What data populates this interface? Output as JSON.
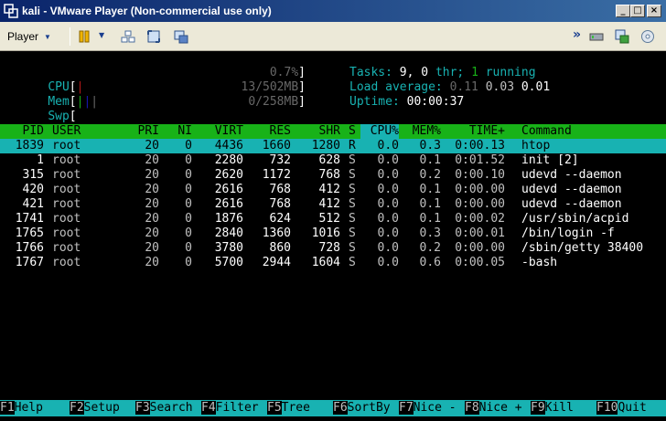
{
  "window": {
    "title": "kali - VMware Player (Non-commercial use only)",
    "min_glyph": "_",
    "max_glyph": "□",
    "close_glyph": "×"
  },
  "toolbar": {
    "player_label": "Player",
    "icons": [
      "pause-icon",
      "send-ctrl-alt-del-icon",
      "fullscreen-icon",
      "unity-icon",
      "forward-icon",
      "network-adapter-icon",
      "usb-device-icon",
      "cd-drive-icon"
    ]
  },
  "meters": {
    "cpu": {
      "label": "CPU",
      "value": "0.7%"
    },
    "mem": {
      "label": "Mem",
      "value": "13/502MB"
    },
    "swp": {
      "label": "Swp",
      "value": "0/258MB"
    }
  },
  "stats": {
    "tasks_label": "Tasks:",
    "tasks_count": "9,",
    "threads_count": "0",
    "threads_label": "thr;",
    "running_count": "1",
    "running_label": "running",
    "load_label": "Load average:",
    "load_1": "0.11",
    "load_5": "0.03",
    "load_15": "0.01",
    "uptime_label": "Uptime:",
    "uptime_value": "00:00:37"
  },
  "columns": {
    "pid": "PID",
    "user": "USER",
    "pri": "PRI",
    "ni": "NI",
    "virt": "VIRT",
    "res": "RES",
    "shr": "SHR",
    "s": "S",
    "cpu": "CPU%",
    "mem": "MEM%",
    "time": "TIME+",
    "command": "Command"
  },
  "processes": [
    {
      "pid": "1839",
      "user": "root",
      "pri": "20",
      "ni": "0",
      "virt": "4436",
      "res": "1660",
      "shr": "1280",
      "s": "R",
      "cpu": "0.0",
      "mem": "0.3",
      "time": "0:00.13",
      "command": "htop"
    },
    {
      "pid": "1",
      "user": "root",
      "pri": "20",
      "ni": "0",
      "virt": "2280",
      "res": "732",
      "shr": "628",
      "s": "S",
      "cpu": "0.0",
      "mem": "0.1",
      "time": "0:01.52",
      "command": "init [2]"
    },
    {
      "pid": "315",
      "user": "root",
      "pri": "20",
      "ni": "0",
      "virt": "2620",
      "res": "1172",
      "shr": "768",
      "s": "S",
      "cpu": "0.0",
      "mem": "0.2",
      "time": "0:00.10",
      "command": "udevd --daemon"
    },
    {
      "pid": "420",
      "user": "root",
      "pri": "20",
      "ni": "0",
      "virt": "2616",
      "res": "768",
      "shr": "412",
      "s": "S",
      "cpu": "0.0",
      "mem": "0.1",
      "time": "0:00.00",
      "command": "udevd --daemon"
    },
    {
      "pid": "421",
      "user": "root",
      "pri": "20",
      "ni": "0",
      "virt": "2616",
      "res": "768",
      "shr": "412",
      "s": "S",
      "cpu": "0.0",
      "mem": "0.1",
      "time": "0:00.00",
      "command": "udevd --daemon"
    },
    {
      "pid": "1741",
      "user": "root",
      "pri": "20",
      "ni": "0",
      "virt": "1876",
      "res": "624",
      "shr": "512",
      "s": "S",
      "cpu": "0.0",
      "mem": "0.1",
      "time": "0:00.02",
      "command": "/usr/sbin/acpid"
    },
    {
      "pid": "1765",
      "user": "root",
      "pri": "20",
      "ni": "0",
      "virt": "2840",
      "res": "1360",
      "shr": "1016",
      "s": "S",
      "cpu": "0.0",
      "mem": "0.3",
      "time": "0:00.01",
      "command": "/bin/login -f"
    },
    {
      "pid": "1766",
      "user": "root",
      "pri": "20",
      "ni": "0",
      "virt": "3780",
      "res": "860",
      "shr": "728",
      "s": "S",
      "cpu": "0.0",
      "mem": "0.2",
      "time": "0:00.00",
      "command": "/sbin/getty 38400"
    },
    {
      "pid": "1767",
      "user": "root",
      "pri": "20",
      "ni": "0",
      "virt": "5700",
      "res": "2944",
      "shr": "1604",
      "s": "S",
      "cpu": "0.0",
      "mem": "0.6",
      "time": "0:00.05",
      "command": "-bash"
    }
  ],
  "footer": [
    {
      "key": "F1",
      "label": "Help"
    },
    {
      "key": "F2",
      "label": "Setup"
    },
    {
      "key": "F3",
      "label": "Search"
    },
    {
      "key": "F4",
      "label": "Filter"
    },
    {
      "key": "F5",
      "label": "Tree"
    },
    {
      "key": "F6",
      "label": "SortBy"
    },
    {
      "key": "F7",
      "label": "Nice -"
    },
    {
      "key": "F8",
      "label": "Nice +"
    },
    {
      "key": "F9",
      "label": "Kill"
    },
    {
      "key": "F10",
      "label": "Quit"
    }
  ],
  "colors": {
    "title_bar": "#0a246a",
    "toolbar_bg": "#ece9d8",
    "terminal_bg": "#000000",
    "header_bar": "#18b218",
    "selected_row": "#18b2b2",
    "accent_cyan": "#18b2b2",
    "accent_green": "#18b218"
  }
}
